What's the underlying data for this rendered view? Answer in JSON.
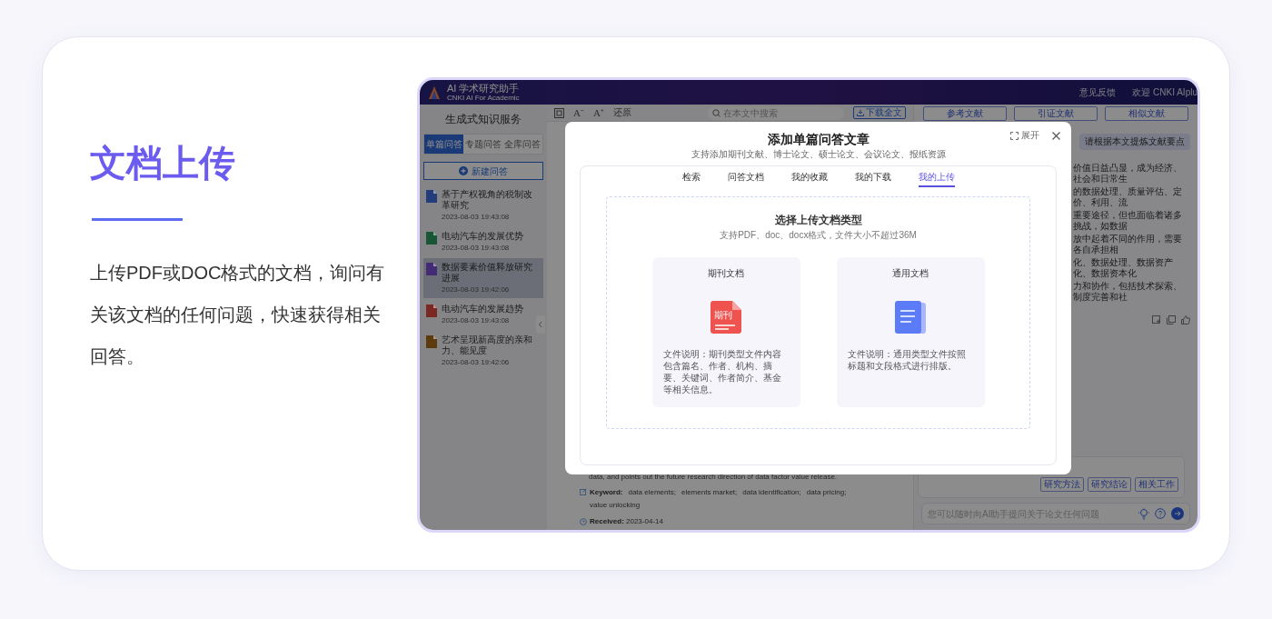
{
  "feature": {
    "title": "文档上传",
    "description": "上传PDF或DOC格式的文档，询问有关该文档的任何问题，快速获得相关回答。"
  },
  "app": {
    "header": {
      "logo_title": "AI 学术研究助手",
      "logo_subtitle": "CNKI AI For Academic",
      "links": [
        "意见反馈",
        "欢迎 CNKI AIplu"
      ]
    },
    "sidebar": {
      "title": "生成式知识服务",
      "tabs": [
        {
          "label": "单篇问答",
          "selected": true
        },
        {
          "label": "专题问答",
          "selected": false
        },
        {
          "label": "全库问答",
          "selected": false
        }
      ],
      "new_button": "新建问答",
      "items": [
        {
          "title": "基于产权视角的税制改革研究",
          "time": "2023-08-03 19:43:08",
          "color": "#223d79",
          "selected": false
        },
        {
          "title": "电动汽车的发展优势",
          "time": "2023-08-03 19:43:08",
          "color": "#195636",
          "selected": false
        },
        {
          "title": "数据要素价值释放研究进展",
          "time": "2023-08-03 19:42:06",
          "color": "#442b76",
          "selected": true
        },
        {
          "title": "电动汽车的发展趋势",
          "time": "2023-08-03 19:43:08",
          "color": "#7b2823",
          "selected": false
        },
        {
          "title": "艺术呈现新高度的亲和力、能见度",
          "time": "2023-08-03 19:42:06",
          "color": "#5c3a0e",
          "selected": false
        }
      ]
    },
    "toolbar": {
      "font_smaller": "A⁻",
      "font_larger": "A⁺",
      "reset": "还原",
      "search_placeholder": "在本文中搜索",
      "download": "下载全文"
    },
    "article": {
      "text": "data, and points out the future research direction of data factor value release.",
      "keyword_label": "Keyword:",
      "keywords": [
        "data elements;",
        "elements market;",
        "data identification;",
        "data pricing;",
        "value unlocking"
      ],
      "received_label": "Received:",
      "received": "2023-04-14"
    },
    "assistant": {
      "tabs": [
        "参考文献",
        "引证文献",
        "相似文献"
      ],
      "prompt": "请根据本文提炼文献要点",
      "answer_lines": [
        "价值日益凸显，成为经济、社会和日常生",
        "的数据处理、质量评估、定价、利用、流",
        "重要途径，但也面临着诸多挑战，如数据",
        "放中起着不同的作用，需要各自承担相",
        "化、数据处理、数据资产化、数据资本化",
        "力和协作，包括技术探索、制度完善和社"
      ],
      "chips": [
        "研究方法",
        "研究结论",
        "相关工作"
      ],
      "input_placeholder": "您可以随时向AI助手提问关于论文任何问题"
    }
  },
  "modal": {
    "title": "添加单篇问答文章",
    "subtitle": "支持添加期刊文献、博士论文、硕士论文、会议论文、报纸资源",
    "expand": "展开",
    "tabs": [
      {
        "label": "检索",
        "selected": false
      },
      {
        "label": "问答文档",
        "selected": false
      },
      {
        "label": "我的收藏",
        "selected": false
      },
      {
        "label": "我的下载",
        "selected": false
      },
      {
        "label": "我的上传",
        "selected": true
      }
    ],
    "upload": {
      "title": "选择上传文档类型",
      "hint": "支持PDF、doc、docx格式，文件大小不超过36M",
      "types": [
        {
          "kind": "journal",
          "title": "期刊文档",
          "badge": "期刊",
          "description": "文件说明：期刊类型文件内容包含篇名、作者、机构、摘要、关键词、作者简介、基金等相关信息。"
        },
        {
          "kind": "general",
          "title": "通用文档",
          "description": "文件说明：通用类型文件按照标题和文段格式进行排版。"
        }
      ]
    }
  }
}
